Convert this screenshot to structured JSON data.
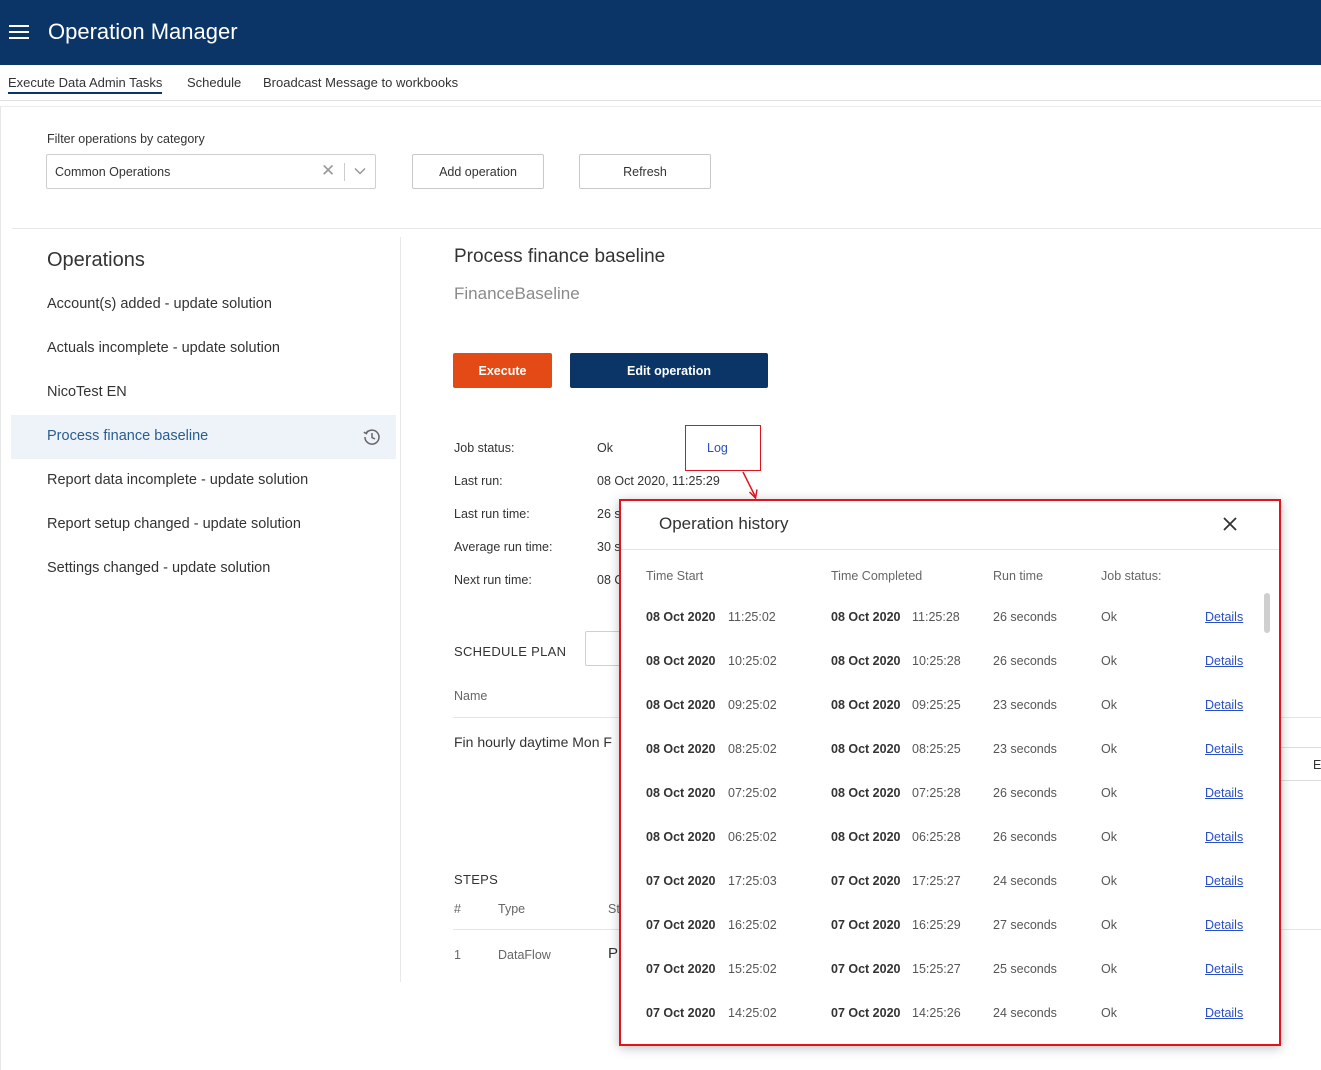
{
  "app": {
    "title": "Operation Manager"
  },
  "tabs": [
    {
      "label": "Execute Data Admin Tasks",
      "active": true
    },
    {
      "label": "Schedule",
      "active": false
    },
    {
      "label": "Broadcast Message to workbooks",
      "active": false
    }
  ],
  "filter": {
    "label": "Filter operations by category",
    "selected": "Common Operations",
    "add_label": "Add operation",
    "refresh_label": "Refresh"
  },
  "operations": {
    "title": "Operations",
    "items": [
      {
        "label": "Account(s) added - update solution"
      },
      {
        "label": "Actuals incomplete - update solution"
      },
      {
        "label": "NicoTest EN"
      },
      {
        "label": "Process finance baseline"
      },
      {
        "label": "Report data incomplete - update solution"
      },
      {
        "label": "Report setup changed - update solution"
      },
      {
        "label": "Settings changed - update solution"
      }
    ],
    "selected_index": 3
  },
  "detail": {
    "title": "Process finance baseline",
    "subtitle": "FinanceBaseline",
    "execute_label": "Execute",
    "edit_label": "Edit operation",
    "fields": [
      {
        "label": "Job status:",
        "value": "Ok"
      },
      {
        "label": "Last run:",
        "value": "08 Oct 2020, 11:25:29"
      },
      {
        "label": "Last run time:",
        "value": "26 s"
      },
      {
        "label": "Average run time:",
        "value": "30 s"
      },
      {
        "label": "Next run time:",
        "value": "08 C"
      }
    ],
    "log_label": "Log",
    "schedule": {
      "title": "SCHEDULE PLAN",
      "name_header": "Name",
      "row_name": "Fin hourly daytime Mon F",
      "side_label": "E"
    },
    "steps": {
      "title": "STEPS",
      "headers": [
        "#",
        "Type",
        "St"
      ],
      "row": [
        "1",
        "DataFlow",
        "P"
      ]
    }
  },
  "history": {
    "title": "Operation history",
    "headers": [
      "Time Start",
      "Time Completed",
      "Run time",
      "Job status:"
    ],
    "details_label": "Details",
    "rows": [
      {
        "start_date": "08 Oct 2020",
        "start_time": "11:25:02",
        "end_date": "08 Oct 2020",
        "end_time": "11:25:28",
        "run_time": "26 seconds",
        "status": "Ok"
      },
      {
        "start_date": "08 Oct 2020",
        "start_time": "10:25:02",
        "end_date": "08 Oct 2020",
        "end_time": "10:25:28",
        "run_time": "26 seconds",
        "status": "Ok"
      },
      {
        "start_date": "08 Oct 2020",
        "start_time": "09:25:02",
        "end_date": "08 Oct 2020",
        "end_time": "09:25:25",
        "run_time": "23 seconds",
        "status": "Ok"
      },
      {
        "start_date": "08 Oct 2020",
        "start_time": "08:25:02",
        "end_date": "08 Oct 2020",
        "end_time": "08:25:25",
        "run_time": "23 seconds",
        "status": "Ok"
      },
      {
        "start_date": "08 Oct 2020",
        "start_time": "07:25:02",
        "end_date": "08 Oct 2020",
        "end_time": "07:25:28",
        "run_time": "26 seconds",
        "status": "Ok"
      },
      {
        "start_date": "08 Oct 2020",
        "start_time": "06:25:02",
        "end_date": "08 Oct 2020",
        "end_time": "06:25:28",
        "run_time": "26 seconds",
        "status": "Ok"
      },
      {
        "start_date": "07 Oct 2020",
        "start_time": "17:25:03",
        "end_date": "07 Oct 2020",
        "end_time": "17:25:27",
        "run_time": "24 seconds",
        "status": "Ok"
      },
      {
        "start_date": "07 Oct 2020",
        "start_time": "16:25:02",
        "end_date": "07 Oct 2020",
        "end_time": "16:25:29",
        "run_time": "27 seconds",
        "status": "Ok"
      },
      {
        "start_date": "07 Oct 2020",
        "start_time": "15:25:02",
        "end_date": "07 Oct 2020",
        "end_time": "15:25:27",
        "run_time": "25 seconds",
        "status": "Ok"
      },
      {
        "start_date": "07 Oct 2020",
        "start_time": "14:25:02",
        "end_date": "07 Oct 2020",
        "end_time": "14:25:26",
        "run_time": "24 seconds",
        "status": "Ok"
      }
    ]
  },
  "colors": {
    "header_bg": "#0a3566",
    "execute_bg": "#e34a15",
    "highlight_border": "#e0141e",
    "link": "#2a4fc0"
  },
  "icons": [
    "menu-icon",
    "close-icon",
    "chevron-down-icon",
    "history-icon",
    "arrow-icon"
  ]
}
